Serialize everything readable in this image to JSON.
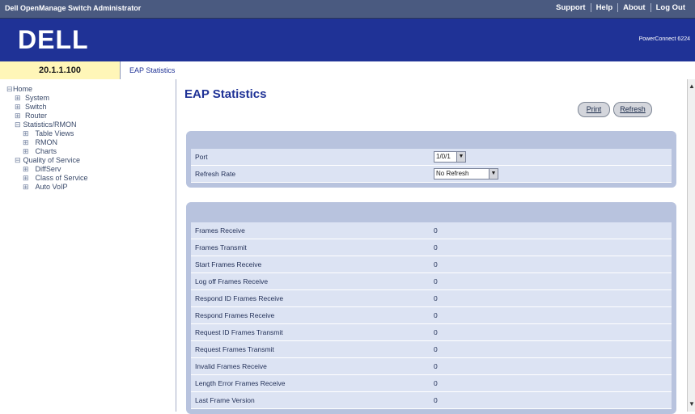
{
  "topbar": {
    "title": "Dell OpenManage Switch Administrator",
    "links": [
      "Support",
      "Help",
      "About",
      "Log Out"
    ]
  },
  "banner": {
    "logo": "DELL",
    "product": "PowerConnect 6224"
  },
  "infobar": {
    "ip": "20.1.1.100",
    "breadcrumb": "EAP Statistics"
  },
  "nav": {
    "items": [
      {
        "label": "Home",
        "exp": "⊟"
      },
      {
        "label": "System",
        "exp": "⊞"
      },
      {
        "label": "Switch",
        "exp": "⊞"
      },
      {
        "label": "Router",
        "exp": "⊞"
      },
      {
        "label": "Statistics/RMON",
        "exp": "⊟"
      },
      {
        "label": "Table Views",
        "exp": "⊞"
      },
      {
        "label": "RMON",
        "exp": "⊞"
      },
      {
        "label": "Charts",
        "exp": "⊞"
      },
      {
        "label": "Quality of Service",
        "exp": "⊟"
      },
      {
        "label": "DiffServ",
        "exp": "⊞"
      },
      {
        "label": "Class of Service",
        "exp": "⊞"
      },
      {
        "label": "Auto VoIP",
        "exp": "⊞"
      }
    ]
  },
  "content": {
    "title": "EAP Statistics",
    "print_label": "Print",
    "refresh_label": "Refresh",
    "config": {
      "port_label": "Port",
      "port_value": "1/0/1",
      "refresh_rate_label": "Refresh Rate",
      "refresh_rate_value": "No Refresh"
    },
    "stats": [
      {
        "label": "Frames Receive",
        "value": "0"
      },
      {
        "label": "Frames Transmit",
        "value": "0"
      },
      {
        "label": "Start Frames Receive",
        "value": "0"
      },
      {
        "label": "Log off Frames Receive",
        "value": "0"
      },
      {
        "label": "Respond ID Frames Receive",
        "value": "0"
      },
      {
        "label": "Respond Frames Receive",
        "value": "0"
      },
      {
        "label": "Request ID Frames Transmit",
        "value": "0"
      },
      {
        "label": "Request Frames Transmit",
        "value": "0"
      },
      {
        "label": "Invalid Frames Receive",
        "value": "0"
      },
      {
        "label": "Length Error Frames Receive",
        "value": "0"
      },
      {
        "label": "Last Frame Version",
        "value": "0"
      }
    ]
  },
  "colors": {
    "topbar": "#4a5a80",
    "banner": "#1f3296",
    "ip_bg": "#fff6b8",
    "panel": "#b8c3de",
    "row": "#dce3f3",
    "selected": "#1f3296"
  }
}
